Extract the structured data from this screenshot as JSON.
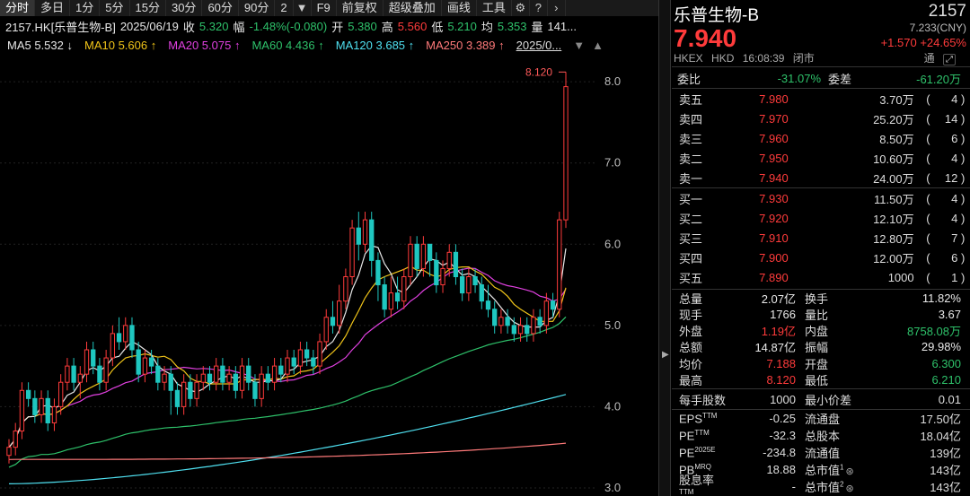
{
  "toolbar": {
    "items": [
      "分时",
      "多日",
      "1分",
      "5分",
      "15分",
      "30分",
      "60分",
      "90分",
      "2"
    ],
    "f9": "F9",
    "fuquan": "前复权",
    "overlay": "超级叠加",
    "draw": "画线",
    "tools": "工具"
  },
  "info": {
    "symbol": "2157.HK[乐普生物-B]",
    "date": "2025/06/19",
    "close_label": "收",
    "close": "5.320",
    "amp_label": "幅",
    "change": "-1.48%(-0.080)",
    "open_label": "开",
    "open": "5.380",
    "high_label": "高",
    "high": "5.560",
    "low_label": "低",
    "low": "5.210",
    "avg_label": "均",
    "avg": "5.353",
    "vol_label": "量",
    "vol": "141..."
  },
  "ma": {
    "ma5": "MA5 5.532",
    "ma5_arrow": "↓",
    "ma10": "MA10 5.606",
    "ma10_arrow": "↑",
    "ma20": "MA20 5.075",
    "ma20_arrow": "↑",
    "ma60": "MA60 4.436",
    "ma60_arrow": "↑",
    "ma120": "MA120 3.685",
    "ma120_arrow": "↑",
    "ma250": "MA250 3.389",
    "ma250_arrow": "↑",
    "date_select": "2025/0..."
  },
  "chart_data": {
    "type": "candlestick",
    "ylim": [
      2.9,
      8.3
    ],
    "yticks": [
      "8.0",
      "7.0",
      "6.0",
      "5.0",
      "4.0",
      "3.0"
    ],
    "max_label": "8.120",
    "candles": [
      [
        3.4,
        3.5,
        3.3,
        3.6
      ],
      [
        3.5,
        3.7,
        3.4,
        3.8
      ],
      [
        3.7,
        4.2,
        3.6,
        4.3
      ],
      [
        4.2,
        4.1,
        4.0,
        4.3
      ],
      [
        4.1,
        3.9,
        3.8,
        4.2
      ],
      [
        3.9,
        4.1,
        3.8,
        4.2
      ],
      [
        4.1,
        3.8,
        3.7,
        4.2
      ],
      [
        3.8,
        4.0,
        3.7,
        4.1
      ],
      [
        4.0,
        4.3,
        3.9,
        4.4
      ],
      [
        4.3,
        4.5,
        4.2,
        4.6
      ],
      [
        4.5,
        4.3,
        4.2,
        4.6
      ],
      [
        4.3,
        4.4,
        4.1,
        4.5
      ],
      [
        4.4,
        4.7,
        4.3,
        4.8
      ],
      [
        4.7,
        4.5,
        4.4,
        4.8
      ],
      [
        4.5,
        4.3,
        4.2,
        4.6
      ],
      [
        4.3,
        4.6,
        4.2,
        4.7
      ],
      [
        4.6,
        4.9,
        4.5,
        5.0
      ],
      [
        4.9,
        4.8,
        4.7,
        5.1
      ],
      [
        4.8,
        5.0,
        4.7,
        5.1
      ],
      [
        5.0,
        4.7,
        4.6,
        5.1
      ],
      [
        4.7,
        4.4,
        4.3,
        4.8
      ],
      [
        4.4,
        4.6,
        4.3,
        4.7
      ],
      [
        4.6,
        4.5,
        4.4,
        4.7
      ],
      [
        4.5,
        4.3,
        4.2,
        4.6
      ],
      [
        4.3,
        4.4,
        4.2,
        4.5
      ],
      [
        4.4,
        4.2,
        3.9,
        4.5
      ],
      [
        4.2,
        4.0,
        3.9,
        4.3
      ],
      [
        4.0,
        4.3,
        3.9,
        4.4
      ],
      [
        4.3,
        4.1,
        4.0,
        4.4
      ],
      [
        4.1,
        4.3,
        4.0,
        4.4
      ],
      [
        4.3,
        4.4,
        4.2,
        4.5
      ],
      [
        4.4,
        4.3,
        4.2,
        4.5
      ],
      [
        4.3,
        4.5,
        4.2,
        4.6
      ],
      [
        4.5,
        4.3,
        4.2,
        4.6
      ],
      [
        4.3,
        4.4,
        4.2,
        4.5
      ],
      [
        4.4,
        4.2,
        4.1,
        4.5
      ],
      [
        4.2,
        4.5,
        4.1,
        4.6
      ],
      [
        4.5,
        4.3,
        4.2,
        4.6
      ],
      [
        4.3,
        4.1,
        4.0,
        4.4
      ],
      [
        4.1,
        4.4,
        4.0,
        4.5
      ],
      [
        4.4,
        4.3,
        4.2,
        4.5
      ],
      [
        4.3,
        4.5,
        4.2,
        4.6
      ],
      [
        4.5,
        4.4,
        4.3,
        4.6
      ],
      [
        4.4,
        4.6,
        4.3,
        4.7
      ],
      [
        4.6,
        4.5,
        4.4,
        4.7
      ],
      [
        4.5,
        4.7,
        4.4,
        4.8
      ],
      [
        4.7,
        4.6,
        4.5,
        4.8
      ],
      [
        4.6,
        4.5,
        4.4,
        4.7
      ],
      [
        4.5,
        4.8,
        4.4,
        4.9
      ],
      [
        4.8,
        5.1,
        4.7,
        5.2
      ],
      [
        5.1,
        5.0,
        4.9,
        5.3
      ],
      [
        5.0,
        5.3,
        4.9,
        5.5
      ],
      [
        5.3,
        5.6,
        5.2,
        5.7
      ],
      [
        5.6,
        6.2,
        5.5,
        6.3
      ],
      [
        6.2,
        6.0,
        5.8,
        6.4
      ],
      [
        6.0,
        6.3,
        5.9,
        6.4
      ],
      [
        6.3,
        5.8,
        5.6,
        6.4
      ],
      [
        5.8,
        5.5,
        5.3,
        5.9
      ],
      [
        5.5,
        5.2,
        5.1,
        5.6
      ],
      [
        5.2,
        5.4,
        5.1,
        5.6
      ],
      [
        5.4,
        5.3,
        5.2,
        5.6
      ],
      [
        5.3,
        5.6,
        5.2,
        5.7
      ],
      [
        5.6,
        6.0,
        5.5,
        6.1
      ],
      [
        6.0,
        5.7,
        5.6,
        6.1
      ],
      [
        5.7,
        6.0,
        5.6,
        6.1
      ],
      [
        6.0,
        5.8,
        5.6,
        6.0
      ],
      [
        5.8,
        5.5,
        5.4,
        5.9
      ],
      [
        5.5,
        5.7,
        5.4,
        5.8
      ],
      [
        5.7,
        5.9,
        5.6,
        6.0
      ],
      [
        5.9,
        5.6,
        5.5,
        6.0
      ],
      [
        5.6,
        5.4,
        5.3,
        5.7
      ],
      [
        5.4,
        5.6,
        5.3,
        5.7
      ],
      [
        5.6,
        5.5,
        5.4,
        5.7
      ],
      [
        5.5,
        5.3,
        5.2,
        5.6
      ],
      [
        5.3,
        5.2,
        5.1,
        5.5
      ],
      [
        5.2,
        5.0,
        4.9,
        5.3
      ],
      [
        5.0,
        5.1,
        4.9,
        5.2
      ],
      [
        5.1,
        5.0,
        4.9,
        5.2
      ],
      [
        5.0,
        4.9,
        4.8,
        5.1
      ],
      [
        4.9,
        5.0,
        4.8,
        5.1
      ],
      [
        5.0,
        4.9,
        4.8,
        5.1
      ],
      [
        4.9,
        5.1,
        4.8,
        5.2
      ],
      [
        5.1,
        5.0,
        4.9,
        5.2
      ],
      [
        5.0,
        5.3,
        4.9,
        5.4
      ],
      [
        5.3,
        5.2,
        5.1,
        5.4
      ],
      [
        5.2,
        6.3,
        5.1,
        6.4
      ],
      [
        6.3,
        7.94,
        6.2,
        8.12
      ]
    ]
  },
  "panel": {
    "name": "乐普生物-B",
    "code": "2157",
    "price": "7.940",
    "cny": "7.233(CNY)",
    "change": "+1.570 +24.65%",
    "exchange": "HKEX",
    "currency": "HKD",
    "time": "16:08:39",
    "status": "闭市",
    "tong": "通",
    "weibi_label": "委比",
    "weibi": "-31.07%",
    "weicha_label": "委差",
    "weicha": "-61.20万",
    "asks": [
      {
        "label": "卖五",
        "price": "7.980",
        "vol": "3.70万",
        "cnt": "4"
      },
      {
        "label": "卖四",
        "price": "7.970",
        "vol": "25.20万",
        "cnt": "14"
      },
      {
        "label": "卖三",
        "price": "7.960",
        "vol": "8.50万",
        "cnt": "6"
      },
      {
        "label": "卖二",
        "price": "7.950",
        "vol": "10.60万",
        "cnt": "4"
      },
      {
        "label": "卖一",
        "price": "7.940",
        "vol": "24.00万",
        "cnt": "12"
      }
    ],
    "bids": [
      {
        "label": "买一",
        "price": "7.930",
        "vol": "11.50万",
        "cnt": "4"
      },
      {
        "label": "买二",
        "price": "7.920",
        "vol": "12.10万",
        "cnt": "4"
      },
      {
        "label": "买三",
        "price": "7.910",
        "vol": "12.80万",
        "cnt": "7"
      },
      {
        "label": "买四",
        "price": "7.900",
        "vol": "12.00万",
        "cnt": "6"
      },
      {
        "label": "买五",
        "price": "7.890",
        "vol": "1000",
        "cnt": "1"
      }
    ],
    "stats": [
      {
        "l1": "总量",
        "v1": "2.07亿",
        "c1": "white",
        "l2": "换手",
        "v2": "11.82%",
        "c2": "white"
      },
      {
        "l1": "现手",
        "v1": "1766",
        "c1": "white",
        "l2": "量比",
        "v2": "3.67",
        "c2": "white"
      },
      {
        "l1": "外盘",
        "v1": "1.19亿",
        "c1": "red",
        "l2": "内盘",
        "v2": "8758.08万",
        "c2": "green"
      },
      {
        "l1": "总额",
        "v1": "14.87亿",
        "c1": "white",
        "l2": "振幅",
        "v2": "29.98%",
        "c2": "white"
      },
      {
        "l1": "均价",
        "v1": "7.188",
        "c1": "red",
        "l2": "开盘",
        "v2": "6.300",
        "c2": "green"
      },
      {
        "l1": "最高",
        "v1": "8.120",
        "c1": "red",
        "l2": "最低",
        "v2": "6.210",
        "c2": "green"
      }
    ],
    "lot_label": "每手股数",
    "lot": "1000",
    "tick_label": "最小价差",
    "tick": "0.01",
    "fund": [
      {
        "l1": "EPS",
        "sup": "TTM",
        "v1": "-0.25",
        "l2": "流通盘",
        "sup2": "",
        "v2": "17.50亿"
      },
      {
        "l1": "PE",
        "sup": "TTM",
        "v1": "-32.3",
        "l2": "总股本",
        "sup2": "",
        "v2": "18.04亿"
      },
      {
        "l1": "PE",
        "sup": "2025E",
        "v1": "-234.8",
        "l2": "流通值",
        "sup2": "",
        "v2": "139亿"
      },
      {
        "l1": "PB",
        "sup": "MRQ",
        "v1": "18.88",
        "l2": "总市值",
        "sup2": "1",
        "v2": "143亿"
      },
      {
        "l1": "股息率",
        "sup": "TTM",
        "v1": "-",
        "l2": "总市值",
        "sup2": "2",
        "v2": "143亿"
      }
    ]
  }
}
